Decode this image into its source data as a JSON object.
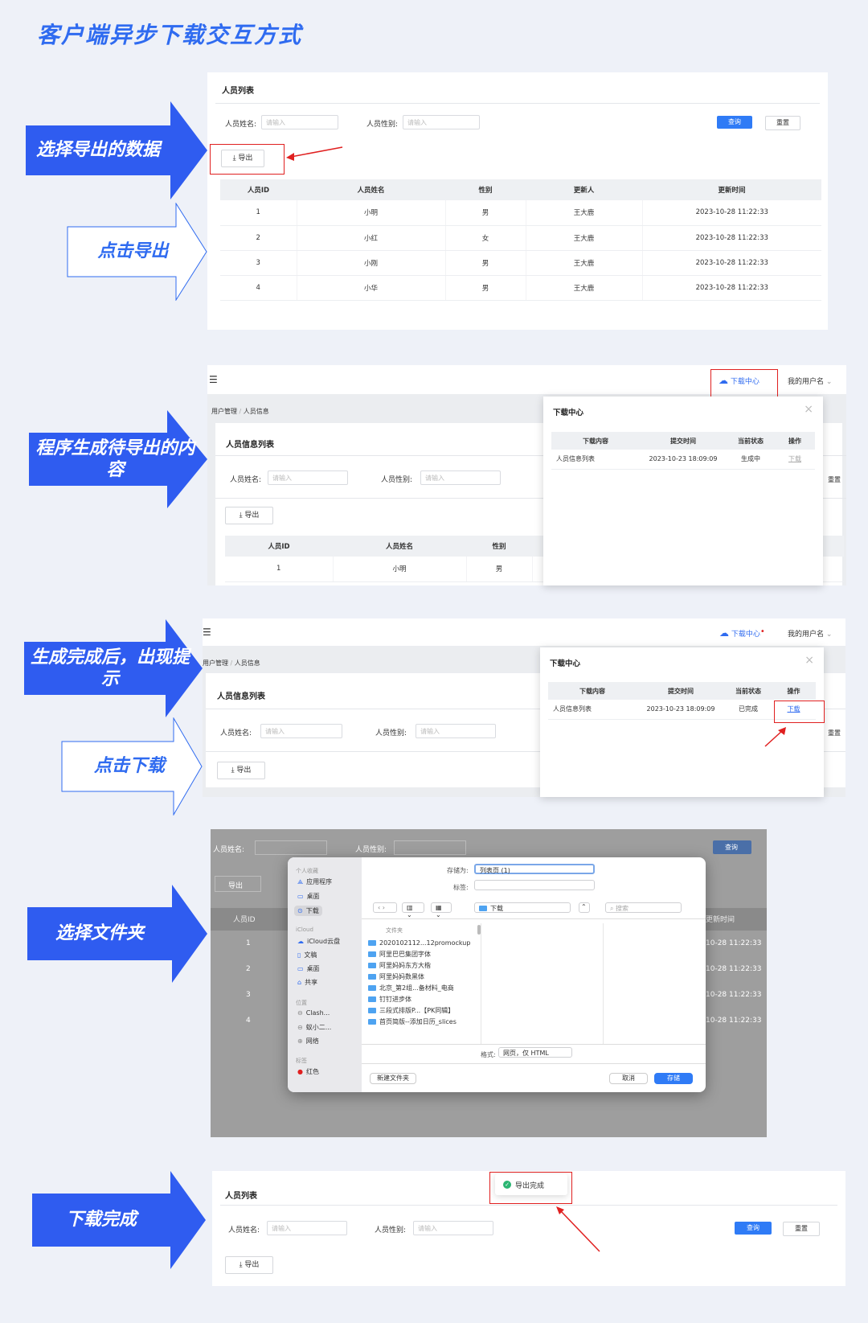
{
  "title": "客户端异步下载交互方式",
  "steps": {
    "s1": "选择导出的数据",
    "s2": "点击导出",
    "s3": "程序生成待导出的内容",
    "s4": "生成完成后，出现提示",
    "s5": "点击下载",
    "s6": "选择文件夹",
    "s7": "下载完成"
  },
  "common": {
    "list_title": "人员列表",
    "info_list_title": "人员信息列表",
    "name_label": "人员姓名:",
    "gender_label": "人员性别:",
    "placeholder": "请输入",
    "query": "查询",
    "reset": "重置",
    "export": "导出",
    "menu_icon": "☰",
    "download_center": "下载中心",
    "username": "我的用户名",
    "breadcrumb_1": "用户管理",
    "breadcrumb_sep": "/",
    "breadcrumb_2": "人员信息"
  },
  "table": {
    "headers": [
      "人员ID",
      "人员姓名",
      "性别",
      "更新人",
      "更新时间"
    ],
    "rows": [
      [
        "1",
        "小明",
        "男",
        "王大鹿",
        "2023-10-28 11:22:33"
      ],
      [
        "2",
        "小红",
        "女",
        "王大鹿",
        "2023-10-28 11:22:33"
      ],
      [
        "3",
        "小刚",
        "男",
        "王大鹿",
        "2023-10-28 11:22:33"
      ],
      [
        "4",
        "小华",
        "男",
        "王大鹿",
        "2023-10-28 11:22:33"
      ]
    ]
  },
  "dc": {
    "headers": [
      "下载内容",
      "提交时间",
      "当前状态",
      "操作"
    ],
    "item": "人员信息列表",
    "time": "2023-10-23 18:09:09",
    "status_gen": "生成中",
    "status_done": "已完成",
    "action": "下载"
  },
  "mac": {
    "sidebar": {
      "fav": "个人收藏",
      "apps": "应用程序",
      "desktop": "桌面",
      "downloads": "下载",
      "icloud": "iCloud",
      "icloud_drive": "iCloud云盘",
      "docs": "文稿",
      "desktop2": "桌面",
      "shared": "共享",
      "locations": "位置",
      "clash": "Clash...",
      "xiaoer": "蚁小二...",
      "network": "网络",
      "tags": "标签",
      "red": "红色"
    },
    "save_as_label": "存储为:",
    "save_as_value": "列表页 (1)",
    "tags_label": "标签:",
    "location": "下载",
    "search": "搜索",
    "folder_header": "文件夹",
    "files": [
      "2020102112...12promockup",
      "阿里巴巴集团字体",
      "阿里妈妈东方大楷",
      "阿里妈妈数黑体",
      "北京_第2组...备材料_电商",
      "钉钉进步体",
      "三段式排版P...【PK同辑】",
      "首页简版--添加日历_slices"
    ],
    "format_label": "格式:",
    "format_value": "网页，仅 HTML",
    "new_folder": "新建文件夹",
    "cancel": "取消",
    "save": "存储",
    "bg_rows": [
      "1",
      "2",
      "3",
      "4"
    ],
    "bg_time": "10-28 11:22:33",
    "bg_id": "人员ID",
    "bg_time_header": "更新时间"
  },
  "toast": "导出完成",
  "colors": {
    "accent": "#2f6bf0",
    "red": "#e02020",
    "success": "#2bb673"
  }
}
